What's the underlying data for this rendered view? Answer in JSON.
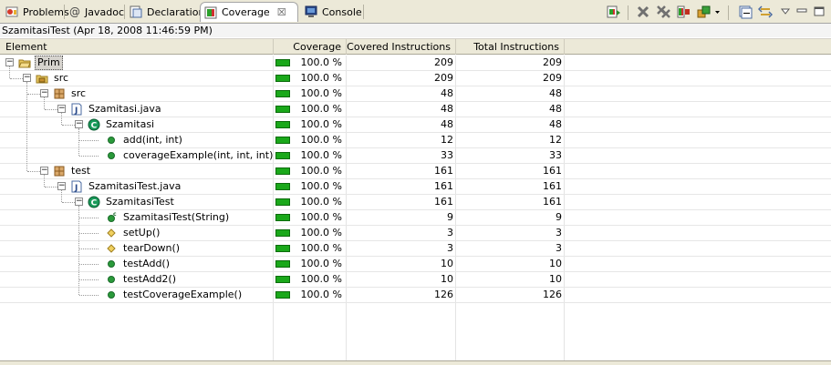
{
  "tabs": [
    {
      "label": "Problems",
      "icon": "problems-icon",
      "active": false
    },
    {
      "label": "Javadoc",
      "icon": "javadoc-icon",
      "active": false
    },
    {
      "label": "Declaration",
      "icon": "declaration-icon",
      "active": false
    },
    {
      "label": "Coverage",
      "icon": "coverage-icon",
      "active": true,
      "close_glyph": "☒"
    },
    {
      "label": "Console",
      "icon": "console-icon",
      "active": false
    }
  ],
  "toolbar": [
    {
      "name": "relaunch-coverage-button",
      "icon": "relaunch-icon"
    },
    {
      "name": "remove-session-button",
      "icon": "remove-icon"
    },
    {
      "name": "remove-all-sessions-button",
      "icon": "remove-all-icon"
    },
    {
      "name": "merge-sessions-button",
      "icon": "merge-icon"
    },
    {
      "name": "select-session-button",
      "icon": "sessions-icon"
    },
    {
      "name": "collapse-all-button",
      "icon": "collapse-all-icon"
    },
    {
      "name": "link-with-editor-button",
      "icon": "link-icon"
    },
    {
      "name": "view-menu-button",
      "icon": "view-menu-icon"
    },
    {
      "name": "minimize-button",
      "icon": "minimize-icon"
    },
    {
      "name": "maximize-button",
      "icon": "maximize-icon"
    }
  ],
  "session_title": "SzamitasiTest (Apr 18, 2008 11:46:59 PM)",
  "columns": [
    "Element",
    "Coverage",
    "Covered Instructions",
    "Total Instructions"
  ],
  "rows": [
    {
      "name": "Prim",
      "type": "project",
      "coverage": "100.0 %",
      "covered": "209",
      "total": "209",
      "selected": true
    },
    {
      "name": "src",
      "type": "folder",
      "coverage": "100.0 %",
      "covered": "209",
      "total": "209"
    },
    {
      "name": "src",
      "type": "package",
      "coverage": "100.0 %",
      "covered": "48",
      "total": "48"
    },
    {
      "name": "Szamitasi.java",
      "type": "java-file",
      "coverage": "100.0 %",
      "covered": "48",
      "total": "48"
    },
    {
      "name": "Szamitasi",
      "type": "class",
      "coverage": "100.0 %",
      "covered": "48",
      "total": "48"
    },
    {
      "name": "add(int, int)",
      "type": "method",
      "coverage": "100.0 %",
      "covered": "12",
      "total": "12"
    },
    {
      "name": "coverageExample(int, int, int)",
      "type": "method",
      "coverage": "100.0 %",
      "covered": "33",
      "total": "33"
    },
    {
      "name": "test",
      "type": "package",
      "coverage": "100.0 %",
      "covered": "161",
      "total": "161"
    },
    {
      "name": "SzamitasiTest.java",
      "type": "java-file",
      "coverage": "100.0 %",
      "covered": "161",
      "total": "161"
    },
    {
      "name": "SzamitasiTest",
      "type": "class",
      "coverage": "100.0 %",
      "covered": "161",
      "total": "161"
    },
    {
      "name": "SzamitasiTest(String)",
      "type": "constructor",
      "coverage": "100.0 %",
      "covered": "9",
      "total": "9"
    },
    {
      "name": "setUp()",
      "type": "protected-method",
      "coverage": "100.0 %",
      "covered": "3",
      "total": "3"
    },
    {
      "name": "tearDown()",
      "type": "protected-method",
      "coverage": "100.0 %",
      "covered": "3",
      "total": "3"
    },
    {
      "name": "testAdd()",
      "type": "method",
      "coverage": "100.0 %",
      "covered": "10",
      "total": "10"
    },
    {
      "name": "testAdd2()",
      "type": "method",
      "coverage": "100.0 %",
      "covered": "10",
      "total": "10"
    },
    {
      "name": "testCoverageExample()",
      "type": "method",
      "coverage": "100.0 %",
      "covered": "126",
      "total": "126"
    }
  ],
  "coverage_fraction": 1.0,
  "colors": {
    "bar_fill": "#1aa81a",
    "selection": "#d6d3ce",
    "class_icon": "#1a9a5a",
    "method_icon": "#2a9a3a",
    "protected_icon": "#e8c23a"
  }
}
